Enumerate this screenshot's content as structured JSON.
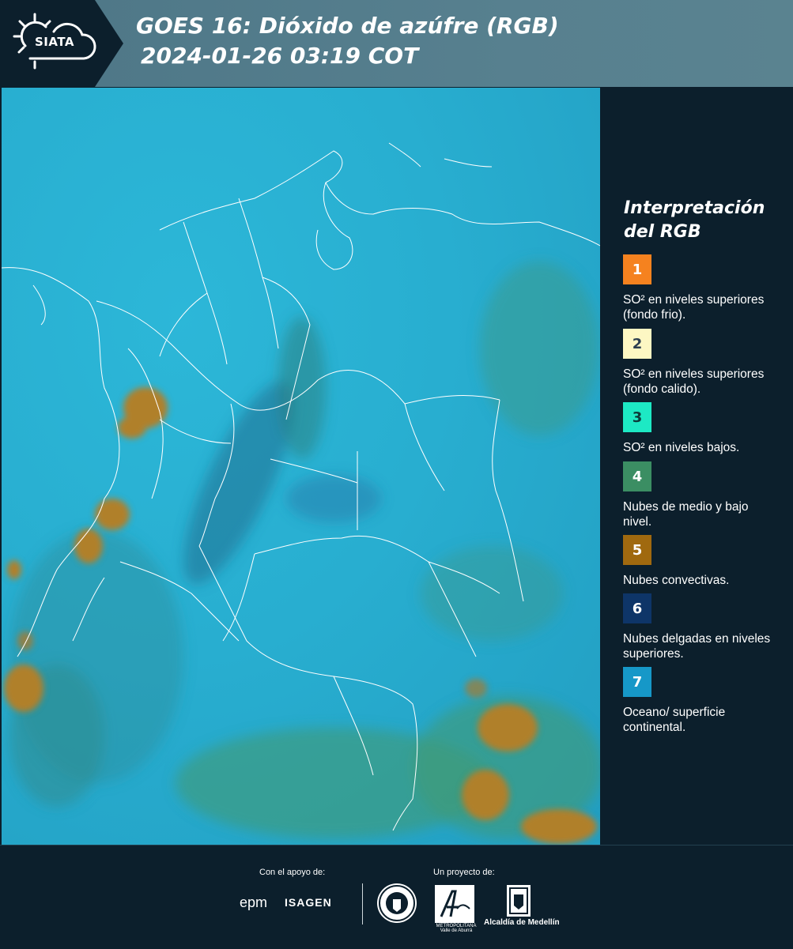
{
  "header": {
    "logo_text": "SIATA",
    "title_line1": "GOES 16: Dióxido de azúfre (RGB)",
    "title_line2": "2024-01-26 03:19 COT"
  },
  "legend": {
    "title_line1": "Interpretación",
    "title_line2": "del RGB",
    "items": [
      {
        "number": "1",
        "label": "SO² en niveles superiores (fondo frio).",
        "color": "#f5821f",
        "text_color": "#ffffff"
      },
      {
        "number": "2",
        "label": "SO² en niveles superiores (fondo calido).",
        "color": "#fdf7c3",
        "text_color": "#2c3e50"
      },
      {
        "number": "3",
        "label": "SO² en niveles bajos.",
        "color": "#1de9c4",
        "text_color": "#0c3b3a"
      },
      {
        "number": "4",
        "label": "Nubes de medio y bajo nivel.",
        "color": "#3b8e63",
        "text_color": "#ffffff"
      },
      {
        "number": "5",
        "label": "Nubes convectivas.",
        "color": "#a0690f",
        "text_color": "#ffffff"
      },
      {
        "number": "6",
        "label": "Nubes delgadas en niveles superiores.",
        "color": "#0e3568",
        "text_color": "#ffffff"
      },
      {
        "number": "7",
        "label": "Oceano/ superficie continental.",
        "color": "#1698c8",
        "text_color": "#ffffff"
      }
    ]
  },
  "footer": {
    "support_label": "Con el apoyo de:",
    "project_label": "Un proyecto de:",
    "epm": "epm",
    "isagen": "ISAGEN",
    "area_text": "METROPOLITANA Valle de Aburrá",
    "alcaldia": "Alcaldía de Medellín"
  },
  "colors": {
    "background": "#0c1f2c",
    "header_band": "#57808f",
    "ocean_land": "#28aed0",
    "boundary": "#ffffff"
  }
}
